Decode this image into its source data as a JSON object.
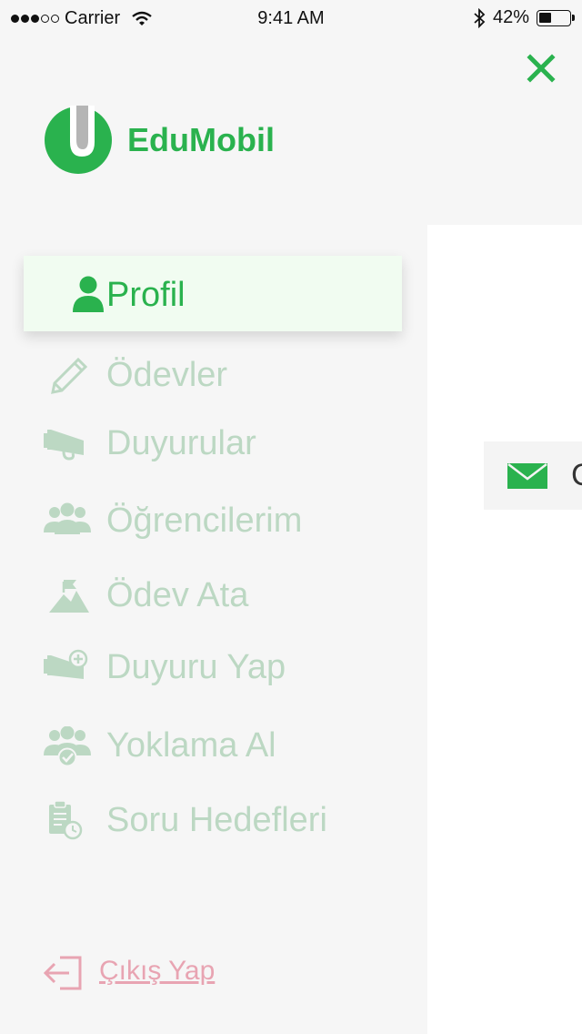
{
  "status_bar": {
    "carrier": "Carrier",
    "time": "9:41 AM",
    "battery_percent_label": "42%",
    "battery_level": 0.42,
    "signal_bars_filled": 3,
    "signal_bars_total": 5
  },
  "app": {
    "name": "EduMobil",
    "brand_color": "#2ab24e"
  },
  "menu": {
    "active": {
      "label": "Profil",
      "icon": "user-icon"
    },
    "items": [
      {
        "label": "Ödevler",
        "icon": "pencil-icon"
      },
      {
        "label": "Duyurular",
        "icon": "megaphone-icon"
      },
      {
        "label": "Öğrencilerim",
        "icon": "students-icon"
      },
      {
        "label": "Ödev Ata",
        "icon": "mountain-flag-icon"
      },
      {
        "label": "Duyuru Yap",
        "icon": "megaphone-plus-icon"
      },
      {
        "label": "Yoklama Al",
        "icon": "group-check-icon"
      },
      {
        "label": "Soru Hedefleri",
        "icon": "clipboard-timer-icon"
      }
    ],
    "inactive_color": "#bcd8c3"
  },
  "logout": {
    "label": "Çıkış Yap",
    "icon": "sign-out-icon",
    "color": "#e8a4b2"
  },
  "background_content": {
    "partial_text": "C"
  }
}
